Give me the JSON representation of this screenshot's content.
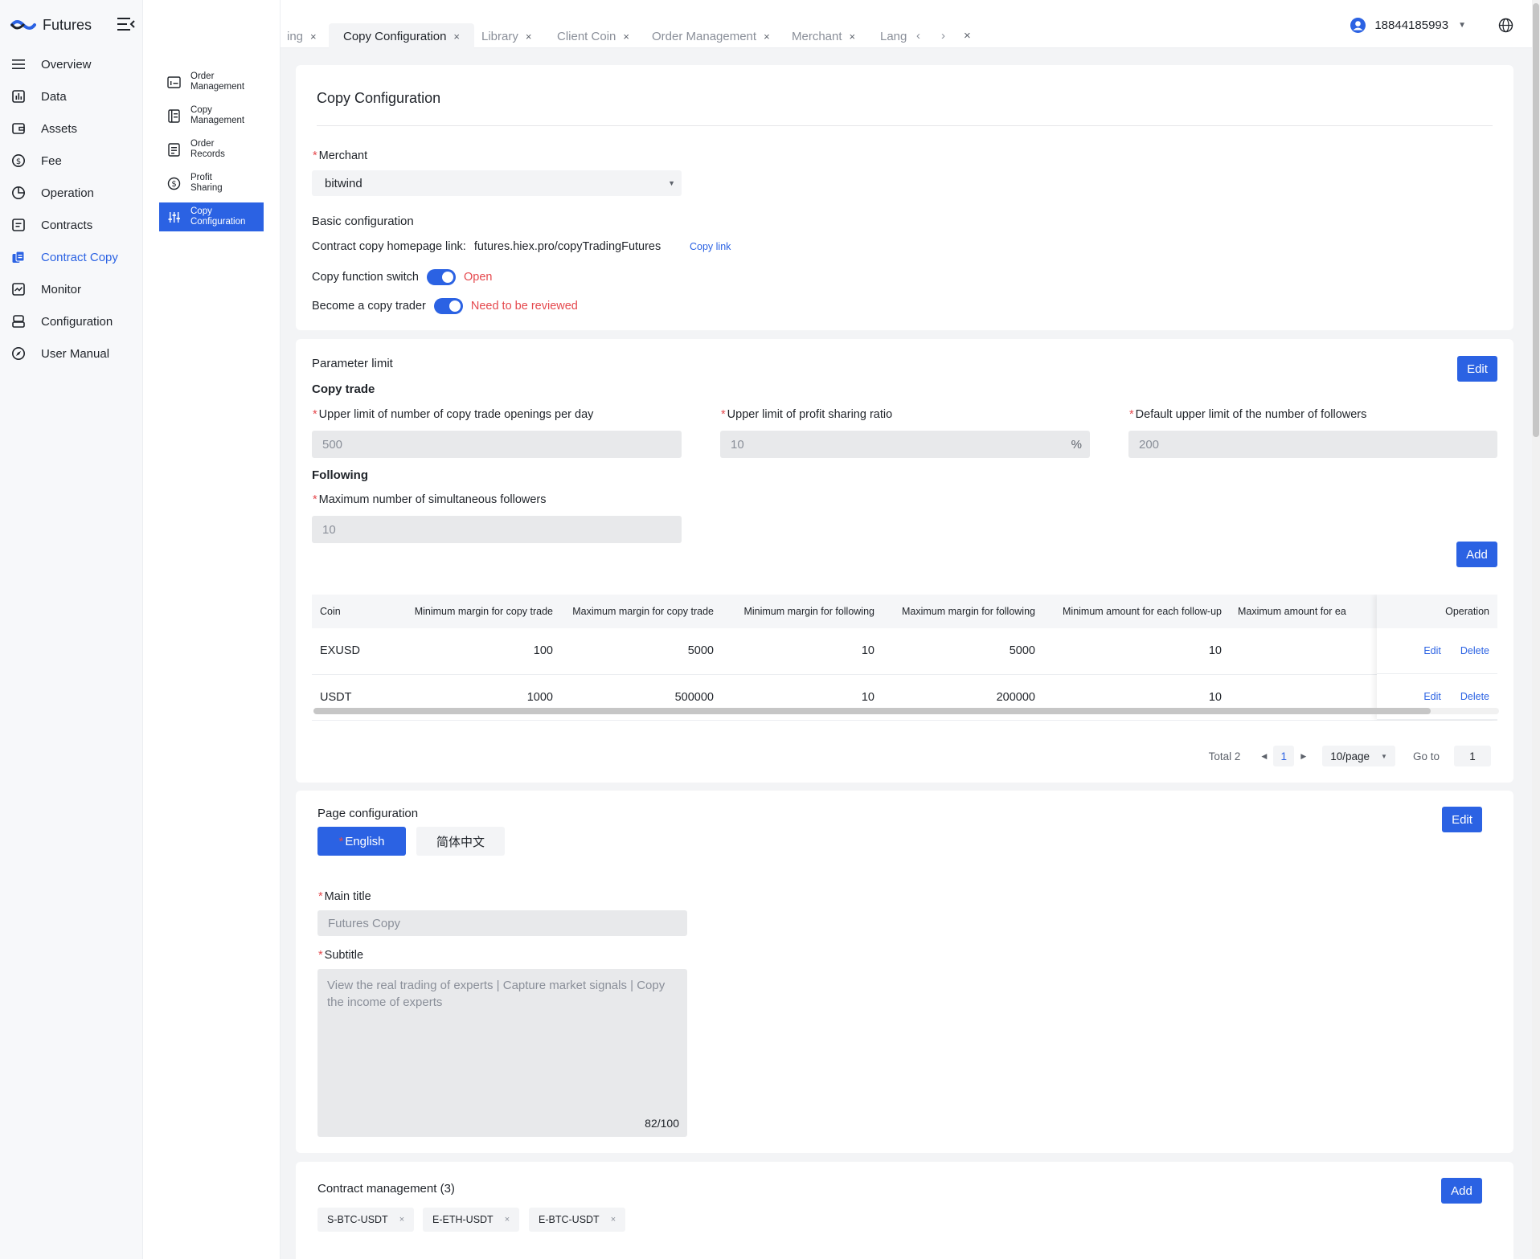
{
  "app": {
    "name": "Futures"
  },
  "nav": {
    "items": [
      {
        "label": "Overview",
        "icon": "menu-icon"
      },
      {
        "label": "Data",
        "icon": "chart-icon"
      },
      {
        "label": "Assets",
        "icon": "wallet-icon"
      },
      {
        "label": "Fee",
        "icon": "dollar-icon"
      },
      {
        "label": "Operation",
        "icon": "pie-icon"
      },
      {
        "label": "Contracts",
        "icon": "contract-icon"
      },
      {
        "label": "Contract Copy",
        "icon": "copy-icon"
      },
      {
        "label": "Monitor",
        "icon": "monitor-icon"
      },
      {
        "label": "Configuration",
        "icon": "config-icon"
      },
      {
        "label": "User Manual",
        "icon": "compass-icon"
      }
    ]
  },
  "subnav": {
    "items": [
      {
        "line1": "Order",
        "line2": "Management"
      },
      {
        "line1": "Copy",
        "line2": "Management"
      },
      {
        "line1": "Order",
        "line2": "Records"
      },
      {
        "line1": "Profit",
        "line2": "Sharing"
      },
      {
        "line1": "Copy",
        "line2": "Configuration"
      }
    ]
  },
  "tabs": {
    "items": [
      "ing",
      "Copy Configuration",
      "Library",
      "Client Coin",
      "Order Management",
      "Merchant",
      "Lang"
    ],
    "close": "×",
    "prev": "‹",
    "next": "›",
    "close_all": "×"
  },
  "user": {
    "phone": "18844185993"
  },
  "page": {
    "title": "Copy Configuration",
    "merchant_label": "Merchant",
    "merchant_value": "bitwind",
    "basic_title": "Basic configuration",
    "homepage_label": "Contract copy homepage link:",
    "homepage_value": "futures.hiex.pro/copyTradingFutures",
    "copy_link": "Copy link",
    "copy_switch_label": "Copy function switch",
    "copy_switch_status": "Open",
    "become_label": "Become a copy trader",
    "become_status": "Need to be reviewed"
  },
  "params": {
    "title": "Parameter limit",
    "edit": "Edit",
    "copy_trade_title": "Copy trade",
    "f1_label": "Upper limit of number of copy trade openings per day",
    "f1_value": "500",
    "f2_label": "Upper limit of profit sharing ratio",
    "f2_value": "10",
    "f2_unit": "%",
    "f3_label": "Default upper limit of the number of followers",
    "f3_value": "200",
    "following_title": "Following",
    "f4_label": "Maximum number of simultaneous followers",
    "f4_value": "10",
    "add": "Add"
  },
  "table": {
    "headers": [
      "Coin",
      "Minimum margin for copy trade",
      "Maximum margin for copy trade",
      "Minimum margin for following",
      "Maximum margin for following",
      "Minimum amount for each follow-up",
      "Maximum amount for ea"
    ],
    "operation_header": "Operation",
    "rows": [
      [
        "EXUSD",
        "100",
        "5000",
        "10",
        "5000",
        "10",
        ""
      ],
      [
        "USDT",
        "1000",
        "500000",
        "10",
        "200000",
        "10",
        ""
      ]
    ],
    "edit": "Edit",
    "delete": "Delete"
  },
  "pager": {
    "total": "Total 2",
    "page": "1",
    "size": "10/page",
    "goto": "Go to",
    "goto_value": "1"
  },
  "page_config": {
    "title": "Page configuration",
    "edit": "Edit",
    "lang_en": "English",
    "lang_zh": "简体中文",
    "main_title_label": "Main title",
    "main_title_value": "Futures Copy",
    "subtitle_label": "Subtitle",
    "subtitle_value": "View the real trading of experts | Capture market signals | Copy the income of experts",
    "subtitle_count": "82/100"
  },
  "contracts": {
    "title": "Contract management (3)",
    "add": "Add",
    "items": [
      "S-BTC-USDT",
      "E-ETH-USDT",
      "E-BTC-USDT"
    ]
  },
  "colors": {
    "accent": "#2b62e3",
    "danger": "#e5484d"
  }
}
